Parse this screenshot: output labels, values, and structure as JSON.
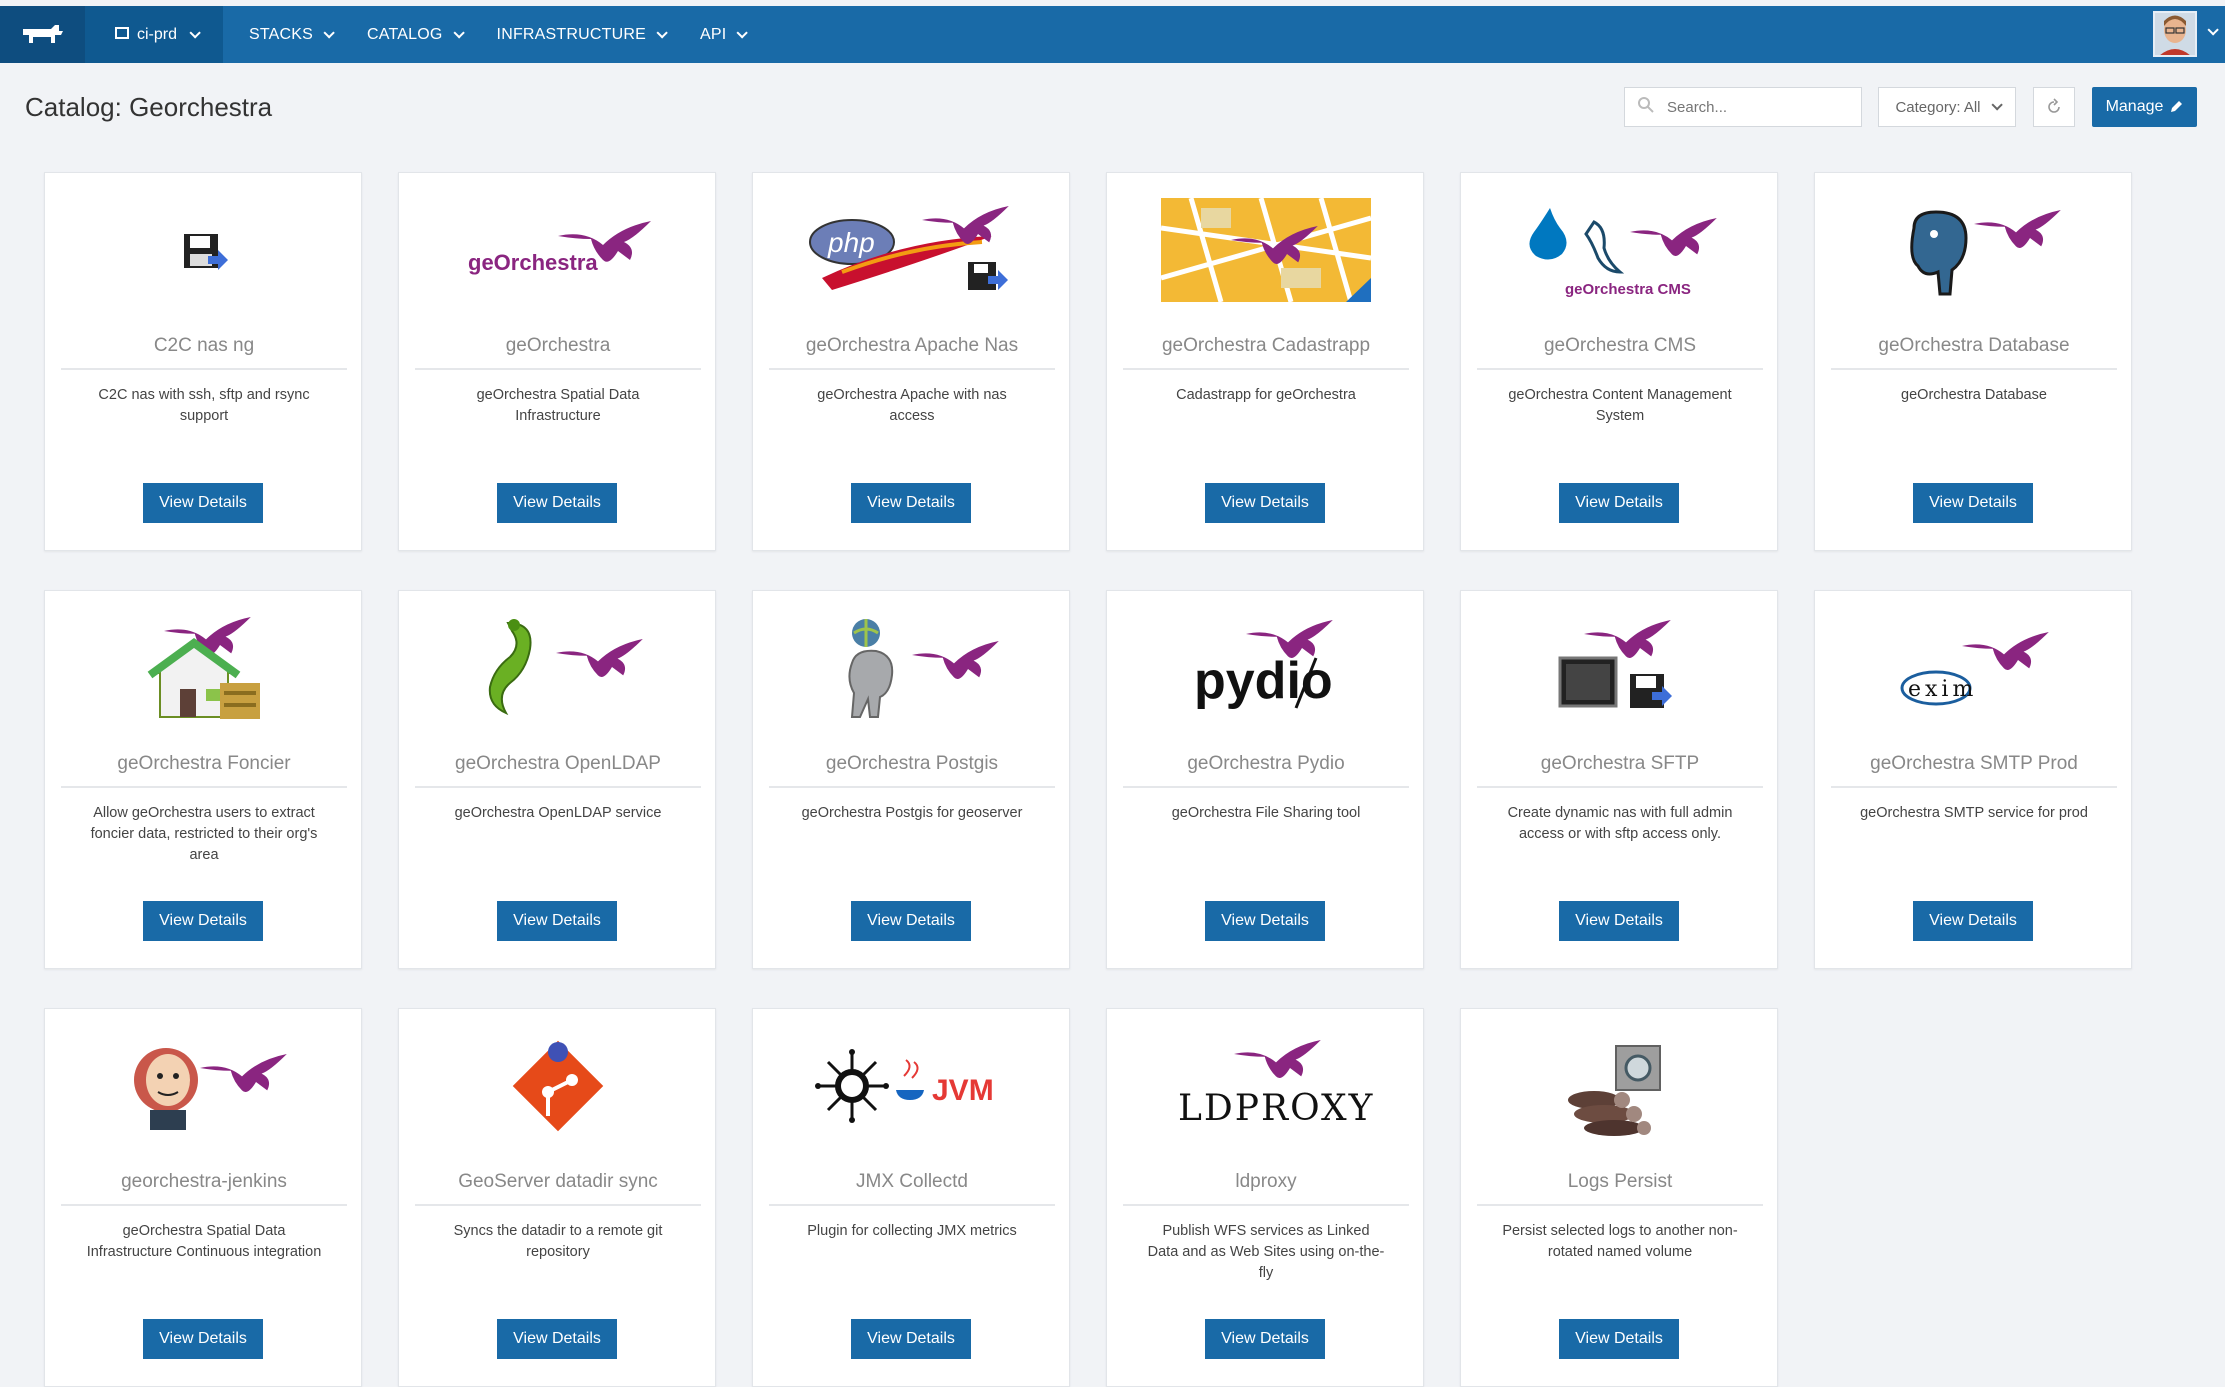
{
  "nav": {
    "environment": "ci-prd",
    "items": [
      "STACKS",
      "CATALOG",
      "INFRASTRUCTURE",
      "API"
    ],
    "logo_icon": "rancher-logo-icon",
    "avatar_icon": "user-avatar-icon"
  },
  "page": {
    "title": "Catalog: Georchestra",
    "search_placeholder": "Search...",
    "category_label": "Category: All",
    "manage_label": "Manage"
  },
  "colors": {
    "primary": "#196aa7",
    "eagle": "#8a2580",
    "background": "#f1f3f6"
  },
  "cards": [
    {
      "title": "C2C nas ng",
      "desc": "C2C nas with ssh, sftp and rsync support",
      "button": "View Details",
      "logo": "floppy-disk-icon"
    },
    {
      "title": "geOrchestra",
      "desc": "geOrchestra Spatial Data Infrastructure",
      "button": "View Details",
      "logo": "georchestra-logo",
      "logo_text": "geOrchestra"
    },
    {
      "title": "geOrchestra Apache Nas",
      "desc": "geOrchestra Apache with nas access",
      "button": "View Details",
      "logo": "php-apache-icon",
      "logo_text": "php"
    },
    {
      "title": "geOrchestra Cadastrapp",
      "desc": "Cadastrapp for geOrchestra",
      "button": "View Details",
      "logo": "cadastre-map-icon"
    },
    {
      "title": "geOrchestra CMS",
      "desc": "geOrchestra Content Management System",
      "button": "View Details",
      "logo": "drupal-cms-icon",
      "logo_text": "geOrchestra CMS"
    },
    {
      "title": "geOrchestra Database",
      "desc": "geOrchestra Database",
      "button": "View Details",
      "logo": "postgres-elephant-icon"
    },
    {
      "title": "geOrchestra Foncier",
      "desc": "Allow geOrchestra users to extract foncier data, restricted to their org's area",
      "button": "View Details",
      "logo": "house-coins-icon"
    },
    {
      "title": "geOrchestra OpenLDAP",
      "desc": "geOrchestra OpenLDAP service",
      "button": "View Details",
      "logo": "openldap-worm-icon"
    },
    {
      "title": "geOrchestra Postgis",
      "desc": "geOrchestra Postgis for geoserver",
      "button": "View Details",
      "logo": "postgis-elephant-globe-icon"
    },
    {
      "title": "geOrchestra Pydio",
      "desc": "geOrchestra File Sharing tool",
      "button": "View Details",
      "logo": "pydio-icon",
      "logo_text": "pydio"
    },
    {
      "title": "geOrchestra SFTP",
      "desc": "Create dynamic nas with full admin access or with sftp access only.",
      "button": "View Details",
      "logo": "terminal-floppy-icon"
    },
    {
      "title": "geOrchestra SMTP Prod",
      "desc": "geOrchestra SMTP service for prod",
      "button": "View Details",
      "logo": "exim-icon",
      "logo_text": "exim"
    },
    {
      "title": "georchestra-jenkins",
      "desc": "geOrchestra Spatial Data Infrastructure Continuous integration",
      "button": "View Details",
      "logo": "jenkins-butler-icon"
    },
    {
      "title": "GeoServer datadir sync",
      "desc": "Syncs the datadir to a remote git repository",
      "button": "View Details",
      "logo": "git-diamond-icon"
    },
    {
      "title": "JMX Collectd",
      "desc": "Plugin for collecting JMX metrics",
      "button": "View Details",
      "logo": "collectd-java-icon",
      "logo_text": "JVM"
    },
    {
      "title": "ldproxy",
      "desc": "Publish WFS services as Linked Data and as Web Sites using on-the-fly",
      "button": "View Details",
      "logo": "ldproxy-logo",
      "logo_text": "LDPROXY"
    },
    {
      "title": "Logs Persist",
      "desc": "Persist selected logs to another non-rotated named volume",
      "button": "View Details",
      "logo": "log-safe-icon"
    }
  ]
}
